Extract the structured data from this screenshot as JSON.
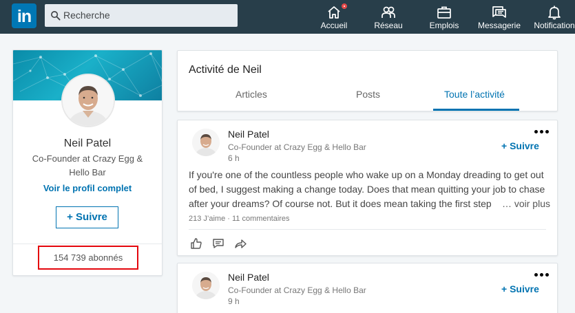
{
  "nav": {
    "logo": "in",
    "search_placeholder": "Recherche",
    "items": [
      {
        "label": "Accueil",
        "icon": "home-icon"
      },
      {
        "label": "Réseau",
        "icon": "network-icon"
      },
      {
        "label": "Emplois",
        "icon": "briefcase-icon"
      },
      {
        "label": "Messagerie",
        "icon": "messaging-icon"
      },
      {
        "label": "Notification",
        "icon": "bell-icon"
      }
    ]
  },
  "profile": {
    "name": "Neil Patel",
    "title": "Co-Founder at Crazy Egg & Hello Bar",
    "link": "Voir le profil complet",
    "follow": "Suivre",
    "followers": "154 739 abonnés"
  },
  "activity": {
    "title": "Activité de Neil",
    "tabs": [
      "Articles",
      "Posts",
      "Toute l’activité"
    ],
    "active_tab": 2
  },
  "posts": [
    {
      "author": "Neil Patel",
      "headline": "Co-Founder at Crazy Egg & Hello Bar",
      "time": "6 h",
      "follow": "Suivre",
      "line1": "If you're one of the countless people who wake up on a Monday dreading to get out",
      "line2": "of bed, I suggest making a change today. Does that mean quitting your job to chase",
      "line3": "after your dreams? Of course not. But it does mean taking the first step",
      "see_more": "… voir plus",
      "likes": "213 J’aime",
      "separator": "·",
      "comments": "11 commentaires"
    },
    {
      "author": "Neil Patel",
      "headline": "Co-Founder at Crazy Egg & Hello Bar",
      "time": "9 h",
      "follow": "Suivre"
    }
  ],
  "colors": {
    "nav_bg": "#283e4a",
    "brand": "#0073b1",
    "highlight_box": "#e4050c"
  }
}
